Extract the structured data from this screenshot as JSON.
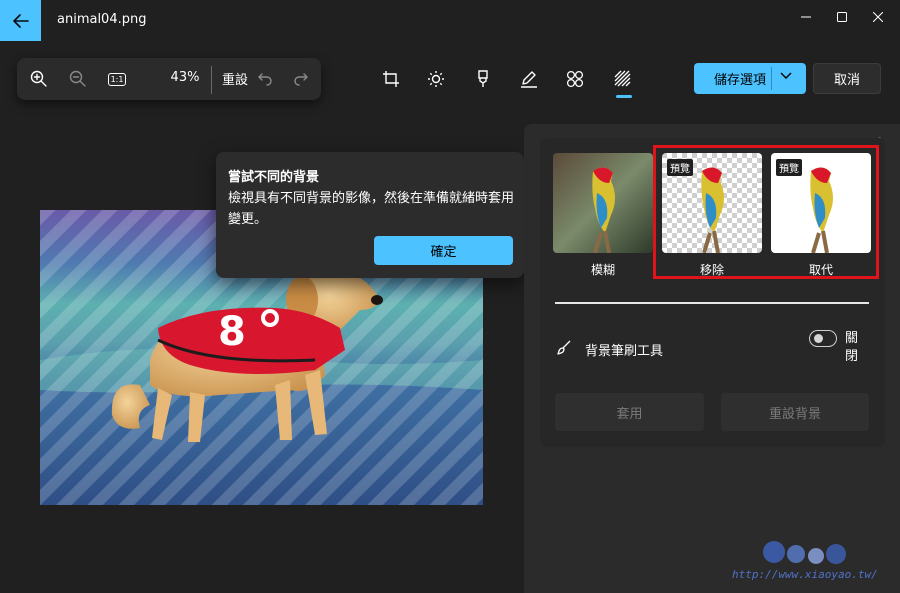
{
  "window": {
    "title": "animal04.png",
    "back_icon": "arrow-left-icon",
    "accent": "#4cc2ff"
  },
  "toolbar": {
    "zoom_in_icon": "zoom-in-icon",
    "zoom_out_icon": "zoom-out-icon",
    "actual_size_label": "1:1",
    "zoom_level": "43%",
    "reset_label": "重設",
    "undo_icon": "undo-icon",
    "redo_icon": "redo-icon"
  },
  "tools": [
    {
      "name": "crop-icon"
    },
    {
      "name": "brightness-icon"
    },
    {
      "name": "markup-icon"
    },
    {
      "name": "draw-icon"
    },
    {
      "name": "retouch-icon"
    },
    {
      "name": "background-icon",
      "active": true
    }
  ],
  "actions": {
    "save_label": "儲存選項",
    "cancel_label": "取消"
  },
  "teaching_tip": {
    "title": "嘗試不同的背景",
    "body": "檢視具有不同背景的影像，然後在準備就緒時套用變更。",
    "ok_label": "確定"
  },
  "background_panel": {
    "options": [
      {
        "label": "模糊",
        "badge": ""
      },
      {
        "label": "移除",
        "badge": "預覽"
      },
      {
        "label": "取代",
        "badge": "預覽"
      }
    ],
    "brush_tool_label": "背景筆刷工具",
    "toggle_label": "關閉",
    "toggle_on": false,
    "apply_label": "套用",
    "reset_background_label": "重設背景",
    "highlight_color": "#e0121a"
  },
  "photo": {
    "jersey_number": "8"
  },
  "watermark": {
    "text": "http://www.xiaoyao.tw/"
  }
}
